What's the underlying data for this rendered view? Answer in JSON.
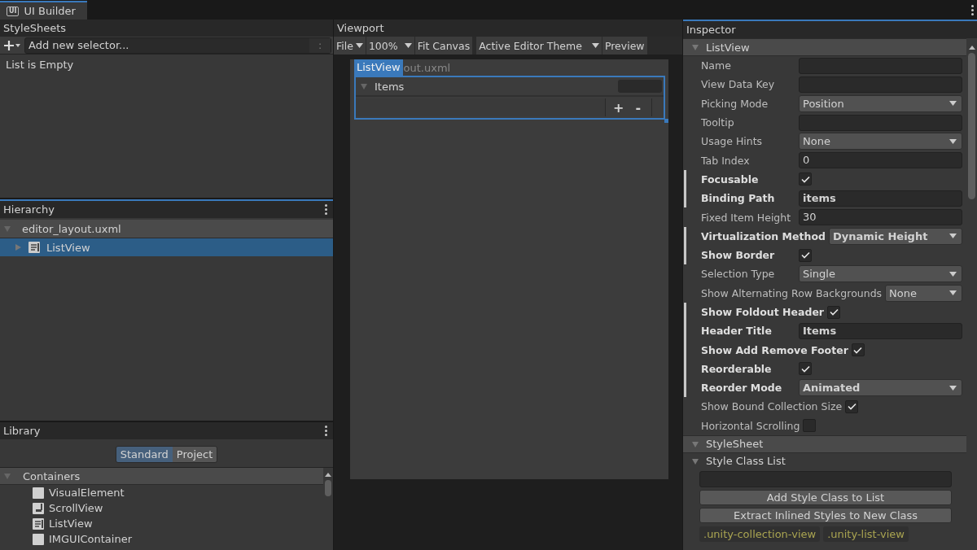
{
  "window_tab": {
    "label": "UI Builder",
    "icon_text": "UI"
  },
  "stylesheets": {
    "title": "StyleSheets",
    "selector_placeholder": "Add new selector...",
    "options_glyph": ":",
    "empty_text": "List is Empty"
  },
  "hierarchy": {
    "title": "Hierarchy",
    "root": {
      "label": "editor_layout.uxml",
      "expanded": true,
      "children": [
        {
          "label": "ListView",
          "selected": true,
          "expanded": false
        }
      ]
    }
  },
  "library": {
    "title": "Library",
    "tabs": [
      {
        "label": "Standard",
        "selected": true
      },
      {
        "label": "Project",
        "selected": false
      }
    ],
    "category": {
      "label": "Containers",
      "expanded": true
    },
    "items": [
      {
        "label": "VisualElement",
        "kind": "element"
      },
      {
        "label": "ScrollView",
        "kind": "scroll"
      },
      {
        "label": "ListView",
        "kind": "list"
      },
      {
        "label": "IMGUIContainer",
        "kind": "element"
      }
    ]
  },
  "viewport": {
    "title": "Viewport",
    "toolbar": [
      {
        "label": "File",
        "kind": "menu"
      },
      {
        "label": "100%",
        "kind": "menu"
      },
      {
        "label": "Fit Canvas",
        "kind": "button"
      },
      {
        "label": "Active Editor Theme",
        "kind": "menu"
      },
      {
        "label": "Preview",
        "kind": "button"
      }
    ],
    "canvas": {
      "element_tag": "ListView",
      "document_name": "out.uxml",
      "foldout_label": "Items",
      "add_glyph": "+",
      "remove_glyph": "-"
    }
  },
  "inspector": {
    "title": "Inspector",
    "section": "ListView",
    "fields": [
      {
        "label": "Name",
        "kind": "text",
        "overridden": false
      },
      {
        "label": "View Data Key",
        "kind": "text",
        "overridden": false
      },
      {
        "label": "Picking Mode",
        "kind": "dropdown",
        "value": "Position",
        "overridden": false
      },
      {
        "label": "Tooltip",
        "kind": "text",
        "overridden": false
      },
      {
        "label": "Usage Hints",
        "kind": "dropdown",
        "value": "None",
        "overridden": false
      },
      {
        "label": "Tab Index",
        "kind": "text",
        "value": "0",
        "overridden": false
      },
      {
        "label": "Focusable",
        "kind": "checkbox",
        "checked": true,
        "overridden": true
      },
      {
        "label": "Binding Path",
        "kind": "text",
        "value": "items",
        "overridden": true
      },
      {
        "label": "Fixed Item Height",
        "kind": "text",
        "value": "30",
        "overridden": false
      },
      {
        "label": "Virtualization Method",
        "kind": "dropdown",
        "value": "Dynamic Height",
        "overridden": true
      },
      {
        "label": "Show Border",
        "kind": "checkbox",
        "checked": true,
        "overridden": true
      },
      {
        "label": "Selection Type",
        "kind": "dropdown",
        "value": "Single",
        "overridden": false
      },
      {
        "label": "Show Alternating Row Backgrounds",
        "kind": "dropdown",
        "value": "None",
        "overridden": false
      },
      {
        "label": "Show Foldout Header",
        "kind": "checkbox",
        "checked": true,
        "overridden": true
      },
      {
        "label": "Header Title",
        "kind": "text",
        "value": "Items",
        "overridden": true
      },
      {
        "label": "Show Add Remove Footer",
        "kind": "checkbox",
        "checked": true,
        "overridden": true
      },
      {
        "label": "Reorderable",
        "kind": "checkbox",
        "checked": true,
        "overridden": true
      },
      {
        "label": "Reorder Mode",
        "kind": "dropdown",
        "value": "Animated",
        "overridden": true
      },
      {
        "label": "Show Bound Collection Size",
        "kind": "checkbox",
        "checked": true,
        "overridden": false
      },
      {
        "label": "Horizontal Scrolling",
        "kind": "checkbox",
        "checked": false,
        "overridden": false
      }
    ],
    "stylesheet_section": "StyleSheet",
    "class_list_section": "Style Class List",
    "buttons": [
      "Add Style Class to List",
      "Extract Inlined Styles to New Class"
    ],
    "classes": [
      ".unity-collection-view",
      ".unity-list-view"
    ]
  }
}
